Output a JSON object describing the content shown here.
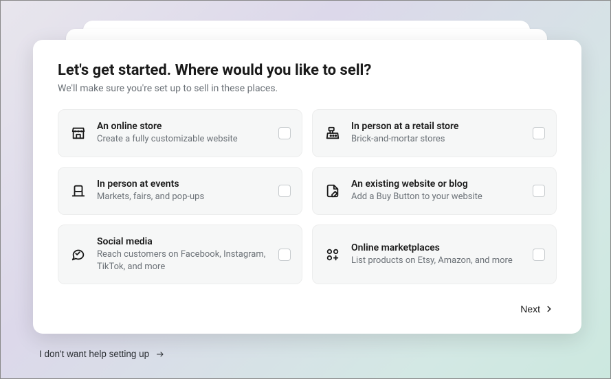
{
  "heading": "Let's get started. Where would you like to sell?",
  "subheading": "We'll make sure you're set up to sell in these places.",
  "options": [
    {
      "title": "An online store",
      "desc": "Create a fully customizable website"
    },
    {
      "title": "In person at a retail store",
      "desc": "Brick-and-mortar stores"
    },
    {
      "title": "In person at events",
      "desc": "Markets, fairs, and pop-ups"
    },
    {
      "title": "An existing website or blog",
      "desc": "Add a Buy Button to your website"
    },
    {
      "title": "Social media",
      "desc": "Reach customers on Facebook, Instagram, TikTok, and more"
    },
    {
      "title": "Online marketplaces",
      "desc": "List products on Etsy, Amazon, and more"
    }
  ],
  "next_label": "Next",
  "skip_label": "I don't want help setting up"
}
